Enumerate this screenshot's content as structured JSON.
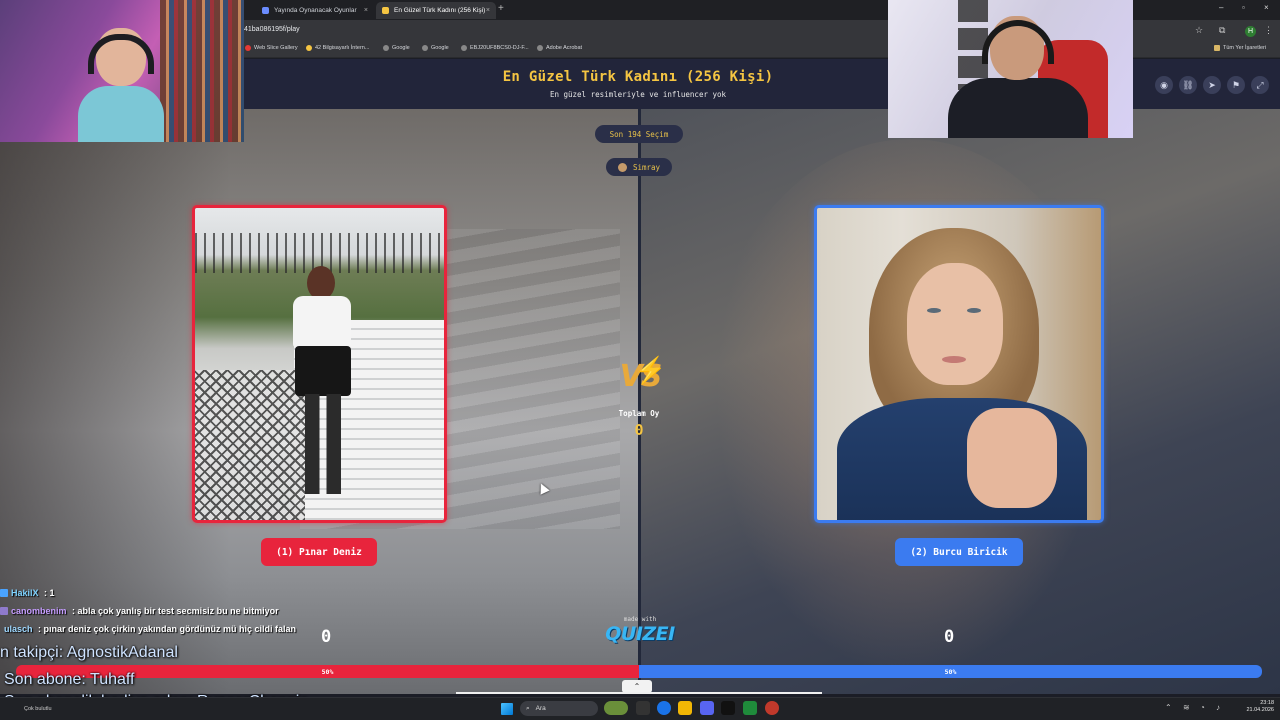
{
  "browser": {
    "tabs": [
      {
        "label": "Yayında Oynanacak Oyunlar",
        "active": false
      },
      {
        "label": "En Güzel Türk Kadını (256 Kişi)",
        "active": true
      }
    ],
    "url": "41ba086195f/play",
    "bookmarks": [
      "Web Slice Gallery",
      "42 Bilgisayarlı İntern...",
      "Google",
      "Google",
      "EBJ20UF8BCS0-DJ-F...",
      "Adobe Acrobat"
    ],
    "bookmarks_folder": "Tüm Yer İşaretleri",
    "profile_initial": "H"
  },
  "game": {
    "title": "En Güzel Türk Kadını (256 Kişi)",
    "subtitle": "En güzel resimleriyle ve influencer yok",
    "round_label": "Son 194 Seçim",
    "creator": "Simray",
    "total_label": "Toplam Oy",
    "total_value": "0",
    "made_with": "made with",
    "brand": "QUIZEI",
    "left": {
      "button": "(1) Pınar Deniz",
      "score": "0",
      "percent": "50%",
      "percent_value": 50
    },
    "right": {
      "button": "(2) Burcu Biricik",
      "score": "0",
      "percent": "50%",
      "percent_value": 50
    }
  },
  "chat": [
    {
      "user": "HakilX",
      "message": " : 1",
      "color": "#7fd3ff"
    },
    {
      "user": "canombenim",
      "message": " : abla çok yanlış bir test secmisiz bu ne bitmiyor",
      "color": "#c59cff"
    },
    {
      "user": "ulasch",
      "message": " : pınar deniz çok çirkin yakından gördünüz mü hiç cildi falan",
      "color": "#9fd8ff"
    }
  ],
  "alerts": {
    "follower": "n takipçi: AgnostikAdanal",
    "subscriber": "Son abone: Tuhaff",
    "gift": "Son abonelik hediye eden: RuzgarChappie"
  },
  "taskbar": {
    "weather": "Çok bulutlu",
    "search_placeholder": "Ara",
    "time": "23:18",
    "date": "21.04.2026"
  },
  "colors": {
    "left_accent": "#e8243c",
    "right_accent": "#3b7bf0",
    "title": "#f5c542"
  }
}
